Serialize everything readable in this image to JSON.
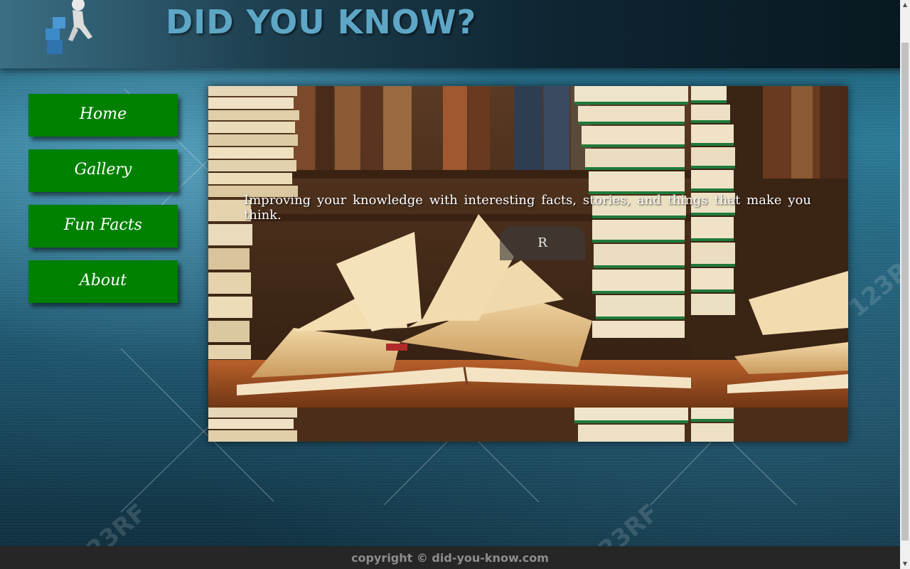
{
  "header": {
    "title": "DID YOU KNOW?",
    "logo_icon": "thinking-figure-icon"
  },
  "nav": {
    "items": [
      {
        "label": "Home"
      },
      {
        "label": "Gallery"
      },
      {
        "label": "Fun Facts"
      },
      {
        "label": "About"
      }
    ]
  },
  "slider": {
    "caption": "Improving your knowledge with interesting facts, stories, and things that make you think.",
    "button_label": "R",
    "image_icon": "open-books-photo"
  },
  "footer": {
    "copyright": "copyright © did-you-know.com"
  },
  "watermark": {
    "text": "123RF"
  },
  "colors": {
    "nav_bg": "#008000",
    "title": "#5ea6c6",
    "footer_bg": "#262626"
  }
}
